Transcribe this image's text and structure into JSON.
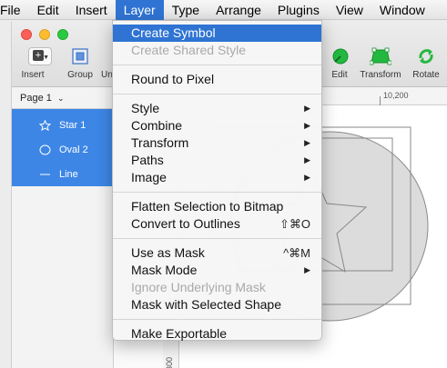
{
  "menubar": {
    "items": [
      "File",
      "Edit",
      "Insert",
      "Layer",
      "Type",
      "Arrange",
      "Plugins",
      "View",
      "Window"
    ],
    "active_index": 3
  },
  "toolbar": {
    "insert_label": "Insert",
    "group_label": "Group",
    "ungroup_partial": "Un",
    "edit_label": "Edit",
    "transform_label": "Transform",
    "rotate_label": "Rotate"
  },
  "layers_panel": {
    "page_label": "Page 1",
    "layers": [
      {
        "name": "Star 1",
        "icon": "star-icon"
      },
      {
        "name": "Oval 2",
        "icon": "oval-icon"
      },
      {
        "name": "Line",
        "icon": "line-icon"
      }
    ]
  },
  "rulers": {
    "top_marker": "10,200",
    "left_marker": "300"
  },
  "layer_menu": {
    "sections": [
      [
        {
          "label": "Create Symbol",
          "selected": true
        },
        {
          "label": "Create Shared Style",
          "disabled": true
        }
      ],
      [
        {
          "label": "Round to Pixel"
        }
      ],
      [
        {
          "label": "Style",
          "submenu": true
        },
        {
          "label": "Combine",
          "submenu": true
        },
        {
          "label": "Transform",
          "submenu": true
        },
        {
          "label": "Paths",
          "submenu": true
        },
        {
          "label": "Image",
          "submenu": true
        }
      ],
      [
        {
          "label": "Flatten Selection to Bitmap"
        },
        {
          "label": "Convert to Outlines",
          "shortcut": "⇧⌘O"
        }
      ],
      [
        {
          "label": "Use as Mask",
          "shortcut": "^⌘M"
        },
        {
          "label": "Mask Mode",
          "submenu": true
        },
        {
          "label": "Ignore Underlying Mask",
          "disabled": true
        },
        {
          "label": "Mask with Selected Shape"
        }
      ],
      [
        {
          "label": "Make Exportable"
        }
      ]
    ]
  },
  "colors": {
    "menu_highlight": "#2f74d3",
    "layer_selection": "#3d86e6",
    "transform_green": "#23b83f"
  }
}
